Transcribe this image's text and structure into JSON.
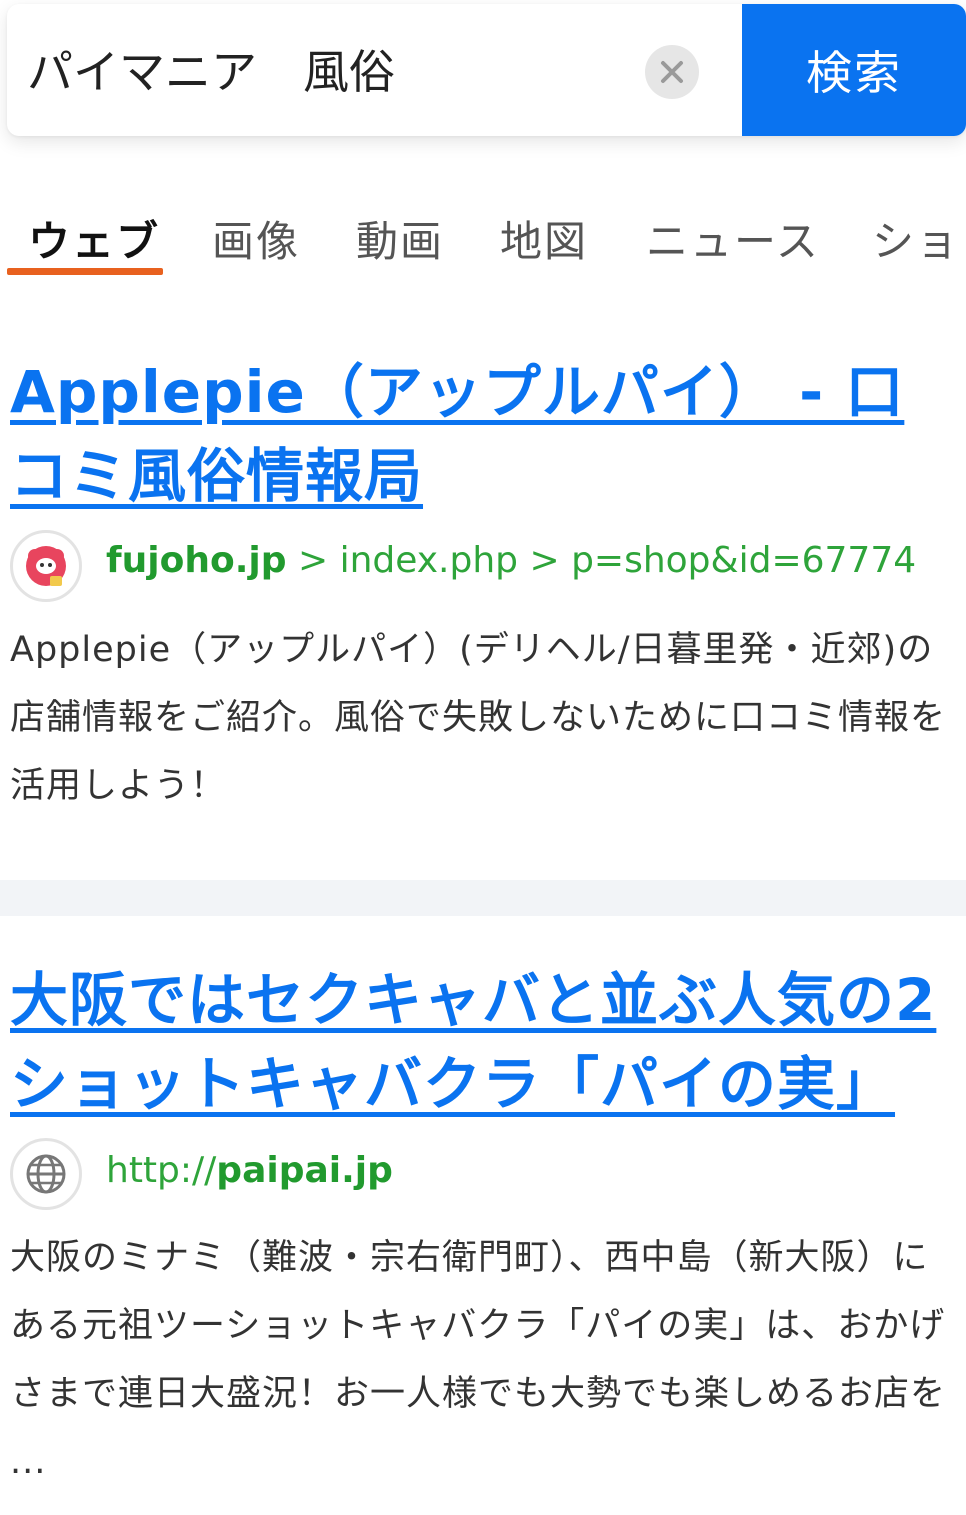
{
  "search": {
    "query": "パイマニア　風俗",
    "clear_label": "×",
    "button_label": "検索"
  },
  "tabs": [
    {
      "label": "ウェブ",
      "active": true
    },
    {
      "label": "画像",
      "active": false
    },
    {
      "label": "動画",
      "active": false
    },
    {
      "label": "地図",
      "active": false
    },
    {
      "label": "ニュース",
      "active": false
    },
    {
      "label": "ショッ",
      "active": false
    }
  ],
  "results": [
    {
      "title": "Applepie（アップルパイ） - 口コミ風俗情報局",
      "domain": "fujoho.jp",
      "url_path": " > index.php > p=shop&id=67774",
      "favicon": "fujoho-mascot-icon",
      "snippet": "Applepie（アップルパイ）(デリヘル/日暮里発・近郊)の店舗情報をご紹介。風俗で失敗しないために口コミ情報を活用しよう！"
    },
    {
      "title": "大阪ではセクキャバと並ぶ人気の2ショットキャバクラ「パイの実」",
      "url_prefix": "http://",
      "domain": "paipai.jp",
      "favicon": "globe-icon",
      "snippet": "大阪のミナミ（難波・宗右衛門町）、西中島（新大阪）にある元祖ツーショットキャバクラ「パイの実」は、おかげさまで連日大盛況！お一人様でも大勢でも楽しめるお店を ..."
    }
  ],
  "colors": {
    "accent": "#0a73f0",
    "tab_indicator": "#e8611f",
    "url_green": "#2ea43a"
  }
}
